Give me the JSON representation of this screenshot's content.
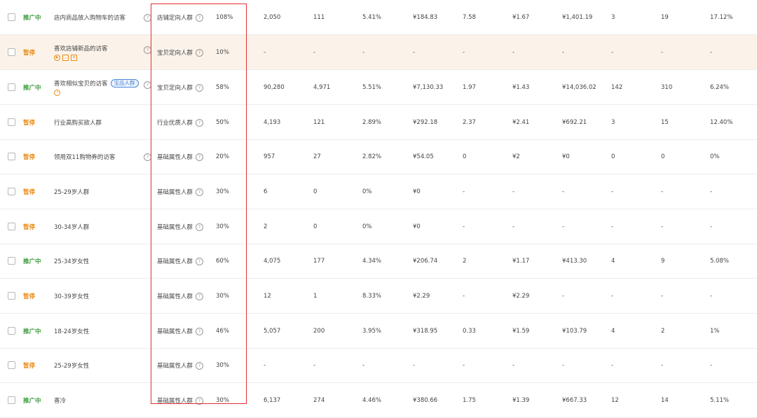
{
  "rows": [
    {
      "status": "推广中",
      "type": "active",
      "name": "店内商品放入购物车的访客",
      "group": "店铺定向人群",
      "ratio": "108%",
      "c1": "2,050",
      "c2": "111",
      "c3": "5.41%",
      "c4": "¥184.83",
      "c5": "7.58",
      "c6": "¥1.67",
      "c7": "¥1,401.19",
      "c8": "3",
      "c9": "19",
      "c10": "17.12%"
    },
    {
      "status": "暂停",
      "type": "paused",
      "name": "喜欢店铺新品的访客",
      "group": "宝贝定向人群",
      "ratio": "10%",
      "c1": "-",
      "c2": "-",
      "c3": "-",
      "c4": "-",
      "c5": "-",
      "c6": "-",
      "c7": "-",
      "c8": "-",
      "c9": "-",
      "c10": "-"
    },
    {
      "status": "推广中",
      "type": "active",
      "name": "喜欢相似宝贝的访客",
      "tag": "宝品人群",
      "group": "宝贝定向人群",
      "ratio": "58%",
      "c1": "90,280",
      "c2": "4,971",
      "c3": "5.51%",
      "c4": "¥7,130.33",
      "c5": "1.97",
      "c6": "¥1.43",
      "c7": "¥14,036.02",
      "c8": "142",
      "c9": "310",
      "c10": "6.24%"
    },
    {
      "status": "暂停",
      "type": "paused",
      "name": "行业高购买欲人群",
      "group": "行业优质人群",
      "ratio": "50%",
      "c1": "4,193",
      "c2": "121",
      "c3": "2.89%",
      "c4": "¥292.18",
      "c5": "2.37",
      "c6": "¥2.41",
      "c7": "¥692.21",
      "c8": "3",
      "c9": "15",
      "c10": "12.40%"
    },
    {
      "status": "暂停",
      "type": "paused",
      "name": "领用双11购物券的访客",
      "group": "基础属性人群",
      "ratio": "20%",
      "c1": "957",
      "c2": "27",
      "c3": "2.82%",
      "c4": "¥54.05",
      "c5": "0",
      "c6": "¥2",
      "c7": "¥0",
      "c8": "0",
      "c9": "0",
      "c10": "0%"
    },
    {
      "status": "暂停",
      "type": "paused",
      "name": "25-29岁人群",
      "group": "基础属性人群",
      "ratio": "30%",
      "c1": "6",
      "c2": "0",
      "c3": "0%",
      "c4": "¥0",
      "c5": "-",
      "c6": "-",
      "c7": "-",
      "c8": "-",
      "c9": "-",
      "c10": "-"
    },
    {
      "status": "暂停",
      "type": "paused",
      "name": "30-34岁人群",
      "group": "基础属性人群",
      "ratio": "30%",
      "c1": "2",
      "c2": "0",
      "c3": "0%",
      "c4": "¥0",
      "c5": "-",
      "c6": "-",
      "c7": "-",
      "c8": "-",
      "c9": "-",
      "c10": "-"
    },
    {
      "status": "推广中",
      "type": "active",
      "name": "25-34岁女性",
      "group": "基础属性人群",
      "ratio": "60%",
      "c1": "4,075",
      "c2": "177",
      "c3": "4.34%",
      "c4": "¥206.74",
      "c5": "2",
      "c6": "¥1.17",
      "c7": "¥413.30",
      "c8": "4",
      "c9": "9",
      "c10": "5.08%"
    },
    {
      "status": "暂停",
      "type": "paused",
      "name": "30-39岁女性",
      "group": "基础属性人群",
      "ratio": "30%",
      "c1": "12",
      "c2": "1",
      "c3": "8.33%",
      "c4": "¥2.29",
      "c5": "-",
      "c6": "¥2.29",
      "c7": "-",
      "c8": "-",
      "c9": "-",
      "c10": "-"
    },
    {
      "status": "推广中",
      "type": "active",
      "name": "18-24岁女性",
      "group": "基础属性人群",
      "ratio": "46%",
      "c1": "5,057",
      "c2": "200",
      "c3": "3.95%",
      "c4": "¥318.95",
      "c5": "0.33",
      "c6": "¥1.59",
      "c7": "¥103.79",
      "c8": "4",
      "c9": "2",
      "c10": "1%"
    },
    {
      "status": "暂停",
      "type": "paused",
      "name": "25-29岁女性",
      "group": "基础属性人群",
      "ratio": "30%",
      "c1": "-",
      "c2": "-",
      "c3": "-",
      "c4": "-",
      "c5": "-",
      "c6": "-",
      "c7": "-",
      "c8": "-",
      "c9": "-",
      "c10": "-"
    },
    {
      "status": "推广中",
      "type": "active",
      "name": "喜冷",
      "group": "基础属性人群",
      "ratio": "30%",
      "c1": "6,137",
      "c2": "274",
      "c3": "4.46%",
      "c4": "¥380.66",
      "c5": "1.75",
      "c6": "¥1.39",
      "c7": "¥667.33",
      "c8": "12",
      "c9": "14",
      "c10": "5.11%"
    }
  ],
  "help_glyph": "?",
  "highlight_color": "#e03030"
}
